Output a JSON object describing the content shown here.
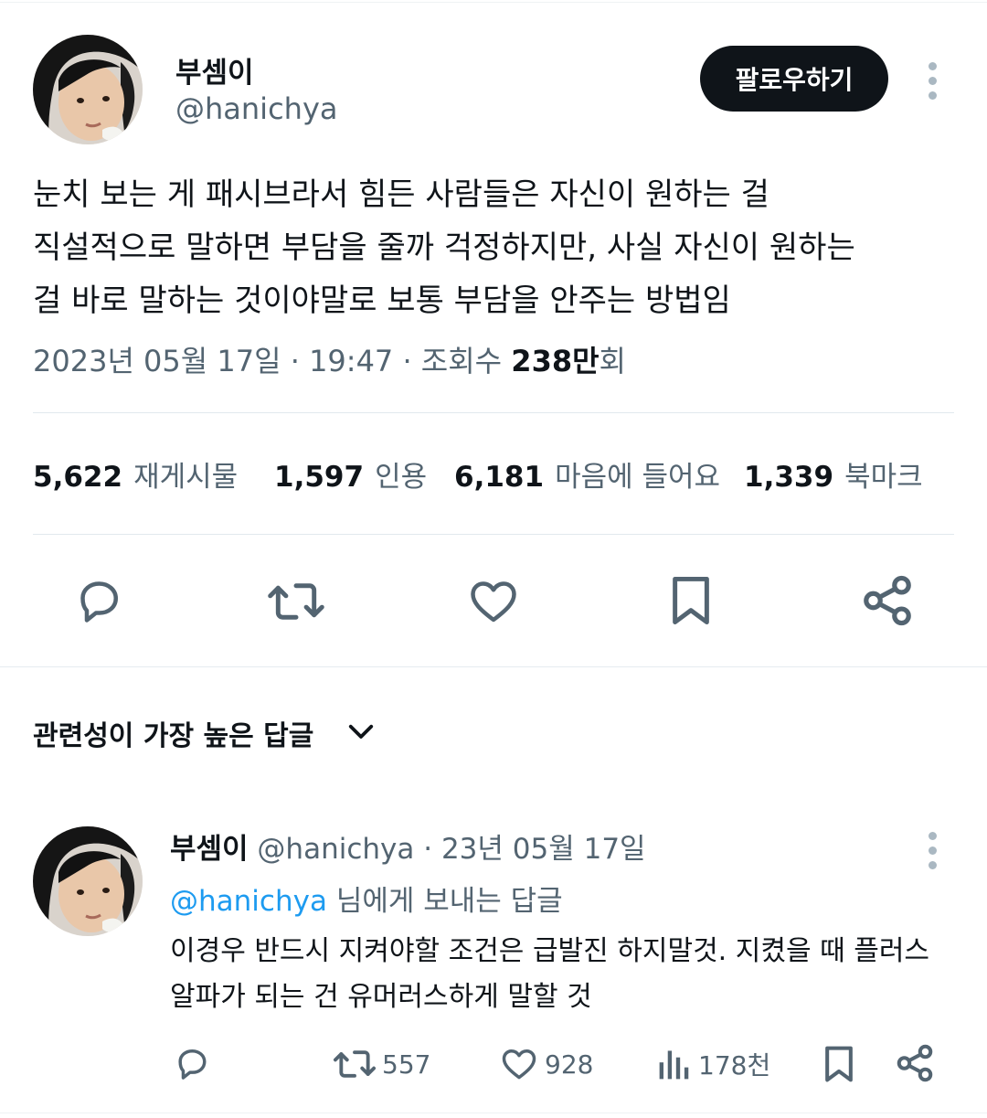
{
  "tweet": {
    "author": {
      "display_name": "부셈이",
      "handle": "@hanichya"
    },
    "follow_label": "팔로우하기",
    "text_lines": [
      "눈치 보는 게 패시브라서 힘든 사람들은 자신이 원하는 걸",
      "직설적으로 말하면 부담을 줄까 걱정하지만, 사실 자신이 원하는",
      "걸 바로 말하는 것이야말로 보통 부담을 안주는 방법임"
    ],
    "meta": {
      "date": "2023년 05월 17일",
      "time": "19:47",
      "views_label": "조회수",
      "views_value": "238만",
      "views_unit": "회"
    },
    "stats": [
      {
        "value": "5,622",
        "label": "재게시물"
      },
      {
        "value": "1,597",
        "label": "인용"
      },
      {
        "value": "6,181",
        "label": "마음에 들어요"
      },
      {
        "value": "1,339",
        "label": "북마크"
      }
    ],
    "actions": [
      "reply-icon",
      "retweet-icon",
      "heart-icon",
      "bookmark-icon",
      "share-icon"
    ]
  },
  "replies_section": {
    "sort_label": "관련성이 가장 높은 답글"
  },
  "reply": {
    "display_name": "부셈이",
    "handle": "@hanichya",
    "date": "23년 05월 17일",
    "reply_to_handle": "@hanichya",
    "reply_to_suffix": "님에게 보내는 답글",
    "text_lines": [
      "이경우 반드시 지켜야할 조건은 급발진 하지말것. 지켰을 때 플러스",
      "알파가 되는 건 유머러스하게 말할 것"
    ],
    "retweets": "557",
    "likes": "928",
    "views": "178천"
  },
  "colors": {
    "text": "#0f1419",
    "secondary": "#536471",
    "link": "#1d9bf0",
    "icon": "#536471",
    "button_bg": "#0f1419"
  }
}
